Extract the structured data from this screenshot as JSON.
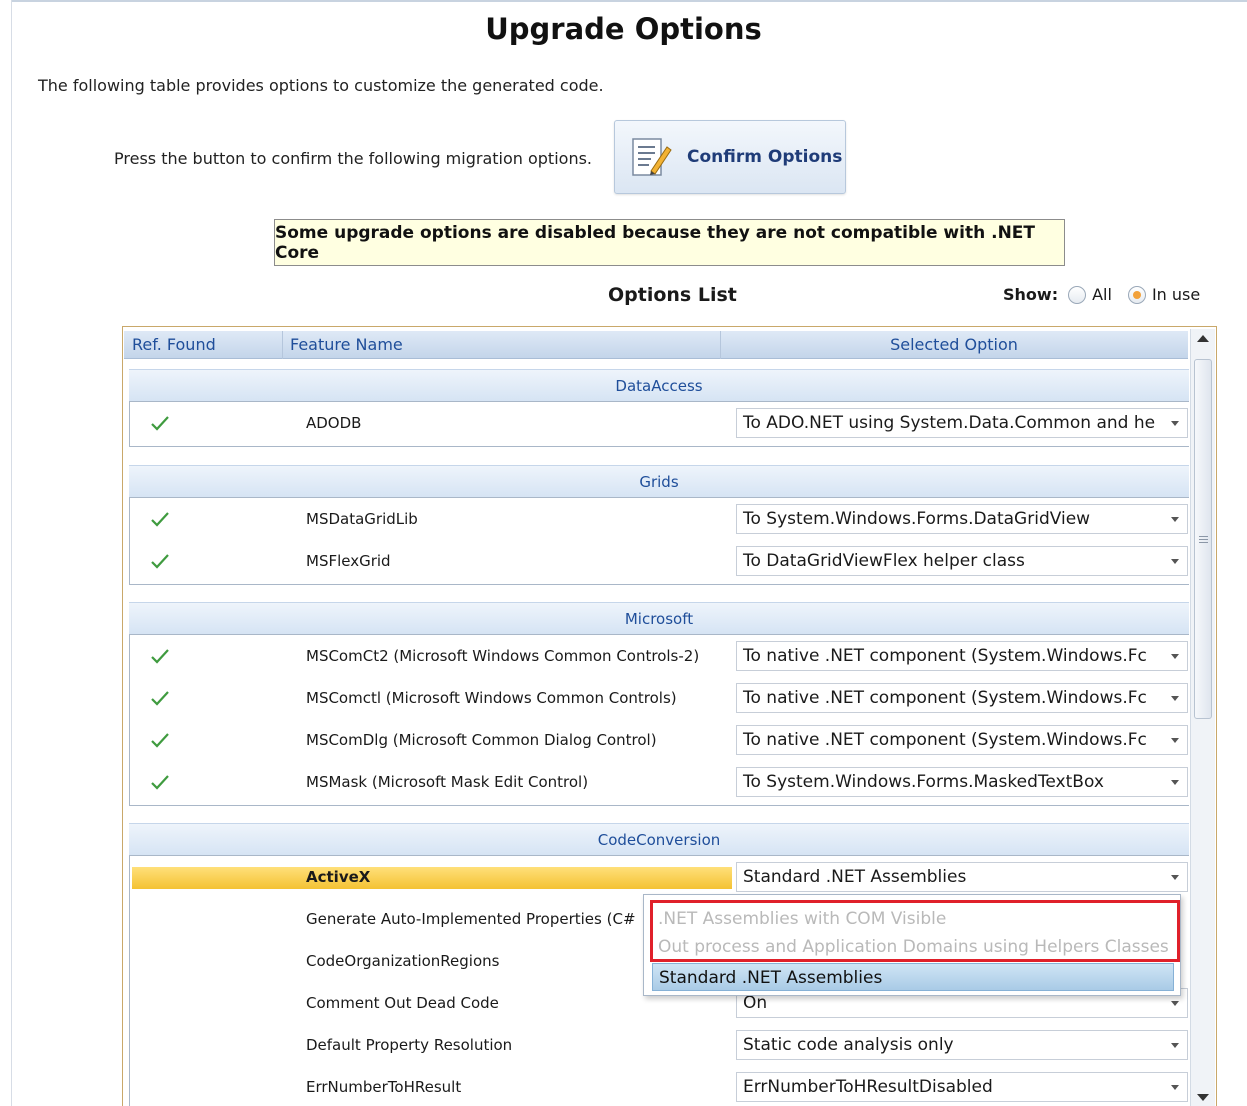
{
  "page": {
    "title": "Upgrade Options",
    "intro": "The following table provides options to customize the generated code.",
    "confirm_prompt": "Press the button to confirm the following migration options.",
    "confirm_button": "Confirm Options",
    "notice": "Some upgrade options are disabled because they are not compatible with .NET Core"
  },
  "options": {
    "title": "Options List",
    "show_label": "Show:",
    "show_choices": [
      "All",
      "In use"
    ],
    "show_selected": "In use"
  },
  "grid": {
    "columns": {
      "ref": "Ref. Found",
      "feature": "Feature Name",
      "selected": "Selected Option"
    },
    "groups": [
      {
        "name": "DataAccess",
        "rows": [
          {
            "ref": true,
            "feature": "ADODB",
            "option": "To ADO.NET using System.Data.Common and he"
          }
        ]
      },
      {
        "name": "Grids",
        "rows": [
          {
            "ref": true,
            "feature": "MSDataGridLib",
            "option": "To System.Windows.Forms.DataGridView"
          },
          {
            "ref": true,
            "feature": "MSFlexGrid",
            "option": "To DataGridViewFlex helper class"
          }
        ]
      },
      {
        "name": "Microsoft",
        "rows": [
          {
            "ref": true,
            "feature": "MSComCt2 (Microsoft Windows Common Controls-2)",
            "option": "To native .NET component (System.Windows.Fc"
          },
          {
            "ref": true,
            "feature": "MSComctl (Microsoft Windows Common Controls)",
            "option": "To native .NET component (System.Windows.Fc"
          },
          {
            "ref": true,
            "feature": "MSComDlg (Microsoft Common Dialog Control)",
            "option": "To native .NET component (System.Windows.Fc"
          },
          {
            "ref": true,
            "feature": "MSMask (Microsoft Mask Edit Control)",
            "option": "To System.Windows.Forms.MaskedTextBox"
          }
        ]
      },
      {
        "name": "CodeConversion",
        "rows": [
          {
            "ref": false,
            "feature": "ActiveX",
            "option": "Standard .NET Assemblies",
            "highlight": true
          },
          {
            "ref": false,
            "feature": "Generate Auto-Implemented Properties (C#",
            "option": ""
          },
          {
            "ref": false,
            "feature": "CodeOrganizationRegions",
            "option": ""
          },
          {
            "ref": false,
            "feature": "Comment Out Dead Code",
            "option": "On"
          },
          {
            "ref": false,
            "feature": "Default Property Resolution",
            "option": "Static code analysis only"
          },
          {
            "ref": false,
            "feature": "ErrNumberToHResult",
            "option": "ErrNumberToHResultDisabled"
          }
        ]
      }
    ]
  },
  "dropdown": {
    "options": [
      {
        "label": ".NET Assemblies with COM Visible",
        "disabled": true
      },
      {
        "label": "Out process and Application Domains using Helpers Classes",
        "disabled": true
      },
      {
        "label": "Standard .NET Assemblies",
        "selected": true
      }
    ],
    "highlight_color": "#e0202a"
  },
  "colors": {
    "header_text": "#1f4e9a",
    "check": "#3f9b3f",
    "notice_bg": "#ffffe1",
    "row_highlight": "#f4c233"
  }
}
